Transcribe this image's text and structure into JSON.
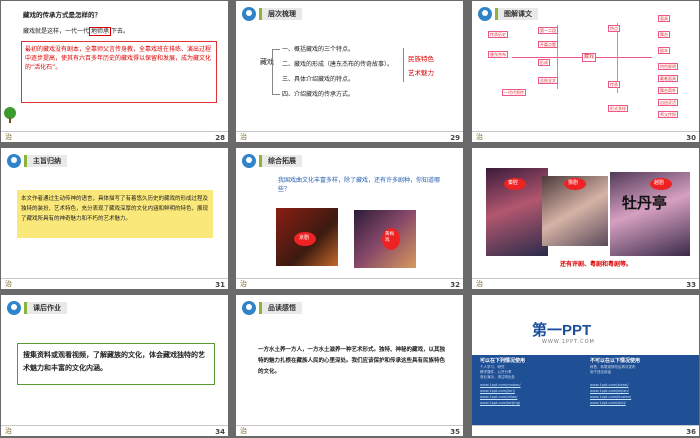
{
  "slides": [
    {
      "num": "28",
      "badge": "治",
      "question": "藏戏的传承方式是怎样的？",
      "answer_pre": "藏戏就是这样，一代一代",
      "answer_mark": "地师承",
      "answer_post": "下去。",
      "box_text": "最初的藏戏没有剧本，全靠师父言传身教，全靠戏班在排练、演出过程中逐步提高，使其有六百多年历史的藏戏得以保留和发展，成为藏文化的“活化石”。"
    },
    {
      "num": "29",
      "badge": "治",
      "title": "层次梳理",
      "left": "藏戏",
      "items": [
        "一、概括藏戏的三个特点。",
        "二、藏戏的形成（唐东杰布的传奇故事）。",
        "三、具体介绍藏戏的特点。",
        "四、介绍藏戏的传承方式。"
      ],
      "right": [
        "民族特色",
        "艺术魅力"
      ]
    },
    {
      "num": "30",
      "badge": "治",
      "title": "图解课文",
      "center": "藏戏",
      "nodes": [
        "第一二段",
        "开篇点题",
        "唐东杰布",
        "形成",
        "特点",
        "面具",
        "舞台",
        "剧本",
        "传承",
        "总结全文",
        "一代代师传",
        "传承历史",
        "特色鲜明",
        "戴着面具",
        "舞台简朴",
        "自由灵活",
        "师父传授",
        "形式多样"
      ]
    },
    {
      "num": "31",
      "badge": "治",
      "title": "主旨归纳",
      "text": "本文作者通过生动传神的语言，具体描写了有着悠久历史的藏戏的形成过程及独特的装扮、艺术特色，充分表现了藏戏深厚的文化内涵和鲜明的特色，展现了藏戏所具有的神奇魅力和不朽的艺术魅力。"
    },
    {
      "num": "32",
      "badge": "治",
      "title": "综合拓展",
      "text": "我国戏曲文化丰富多样，除了藏戏，还有许多剧种，你知道哪些？",
      "labels": [
        "京剧",
        "黄梅戏"
      ]
    },
    {
      "num": "33",
      "badge": "治",
      "labels": [
        "秦腔",
        "豫剧",
        "越剧"
      ],
      "big": "牡丹亭",
      "caption": "还有评剧、粤剧和粤剧等。"
    },
    {
      "num": "34",
      "badge": "治",
      "title": "课后作业",
      "text": "搜集资料或观看视频，了解藏族的文化，体会藏戏独特的艺术魅力和丰富的文化内涵。"
    },
    {
      "num": "35",
      "badge": "治",
      "title": "品读感悟",
      "text": "一方水土养一方人，一方水土滋养一种艺术形式。独特、神秘的藏戏，以其独特的魅力扎根在藏族人民的心里深处。我们应该保护和传承这些具有民族特色的文化。"
    },
    {
      "num": "36",
      "badge": "",
      "logo": "第一PPT",
      "url": "WWW.1PPT.COM",
      "col1_title": "可以在下列情况使用",
      "col2_title": "不可以在以下情况使用",
      "col1_items": [
        "个人学习、研究",
        "教学课件、公开分享",
        "商业演示，请注明出处"
      ],
      "col2_items": [
        "转售、转载或修改后再次发布",
        "用于违法用途"
      ],
      "links": [
        "www.1ppt.com/moban/",
        "www.1ppt.com/jieri/",
        "www.1ppt.com/ziliao/",
        "www.1ppt.com/beijing/",
        "www.1ppt.com/xiazai/",
        "www.1ppt.com/kejian/",
        "www.1ppt.com/fanwen/",
        "www.1ppt.com/shiti/"
      ]
    }
  ]
}
